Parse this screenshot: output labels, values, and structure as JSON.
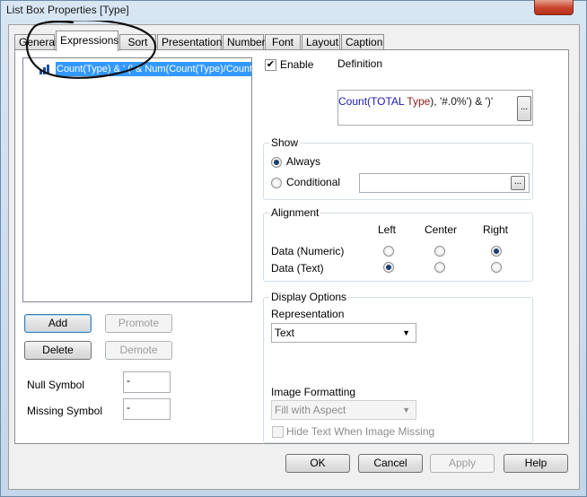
{
  "window": {
    "title": "List Box Properties [Type]"
  },
  "tabs": [
    {
      "label": "General"
    },
    {
      "label": "Expressions"
    },
    {
      "label": "Sort"
    },
    {
      "label": "Presentation"
    },
    {
      "label": "Number"
    },
    {
      "label": "Font"
    },
    {
      "label": "Layout"
    },
    {
      "label": "Caption"
    }
  ],
  "expressions": {
    "items": [
      {
        "text": "Count(Type) & ' (' & Num(Count(Type)/Count"
      }
    ],
    "buttons": {
      "add": "Add",
      "promote": "Promote",
      "delete": "Delete",
      "demote": "Demote"
    }
  },
  "null_symbol": {
    "label": "Null Symbol",
    "value": "-"
  },
  "missing_symbol": {
    "label": "Missing Symbol",
    "value": "-"
  },
  "enable": {
    "label": "Enable",
    "checked": true
  },
  "definition": {
    "label": "Definition",
    "parts": [
      {
        "text": "Count(",
        "color": "#1a1ab0"
      },
      {
        "text": "TOTAL ",
        "color": "#1a1ab0"
      },
      {
        "text": "Type",
        "color": "#8a1a1a"
      },
      {
        "text": "), '#.0%') & ')'",
        "color": "#1a1a1a"
      }
    ]
  },
  "show": {
    "title": "Show",
    "always": "Always",
    "conditional": "Conditional",
    "selected": "always"
  },
  "alignment": {
    "title": "Alignment",
    "columns": [
      "Left",
      "Center",
      "Right"
    ],
    "rows": [
      {
        "label": "Data (Numeric)",
        "selected": "Right"
      },
      {
        "label": "Data (Text)",
        "selected": "Left"
      }
    ]
  },
  "display_options": {
    "title": "Display Options",
    "representation_label": "Representation",
    "representation_value": "Text",
    "image_formatting_label": "Image Formatting",
    "image_formatting_value": "Fill with Aspect",
    "hide_text_label": "Hide Text When Image Missing"
  },
  "footer": {
    "ok": "OK",
    "cancel": "Cancel",
    "apply": "Apply",
    "help": "Help"
  },
  "colors": {
    "selection": "#3399ff",
    "annotation": "#111111"
  },
  "icons": {
    "expression_item": "bar-chart-icon",
    "ellipsis": "ellipsis-icon",
    "close": "close-icon"
  }
}
